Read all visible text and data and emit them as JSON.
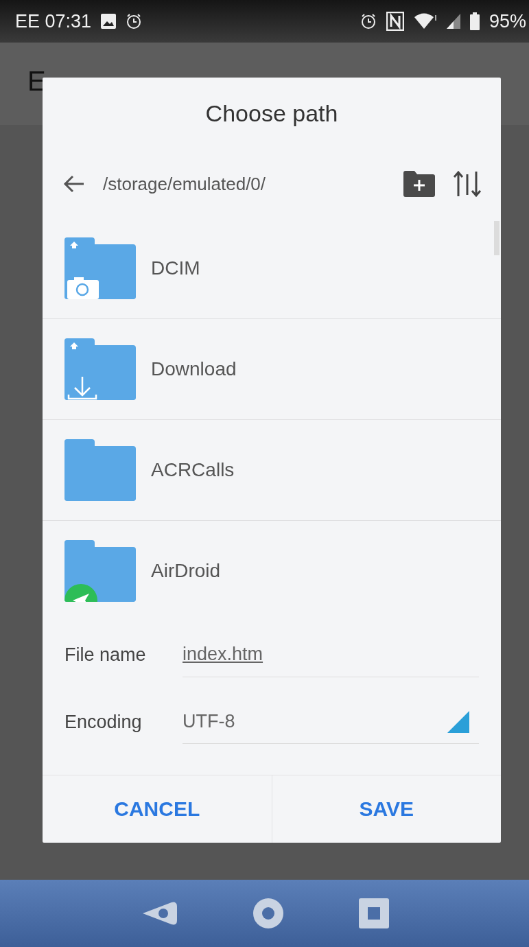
{
  "status_bar": {
    "carrier_time": "EE 07:31",
    "battery": "95%"
  },
  "app_bar": {
    "title": "E"
  },
  "dialog": {
    "title": "Choose path",
    "path": "/storage/emulated/0/",
    "folders": [
      {
        "name": "DCIM",
        "kind": "camera"
      },
      {
        "name": "Download",
        "kind": "download"
      },
      {
        "name": "ACRCalls",
        "kind": "plain"
      },
      {
        "name": "AirDroid",
        "kind": "airdroid"
      }
    ],
    "file_name": {
      "label": "File name",
      "value": "index.htm"
    },
    "encoding": {
      "label": "Encoding",
      "value": "UTF-8"
    },
    "buttons": [
      {
        "label": "CANCEL"
      },
      {
        "label": "SAVE"
      }
    ]
  }
}
